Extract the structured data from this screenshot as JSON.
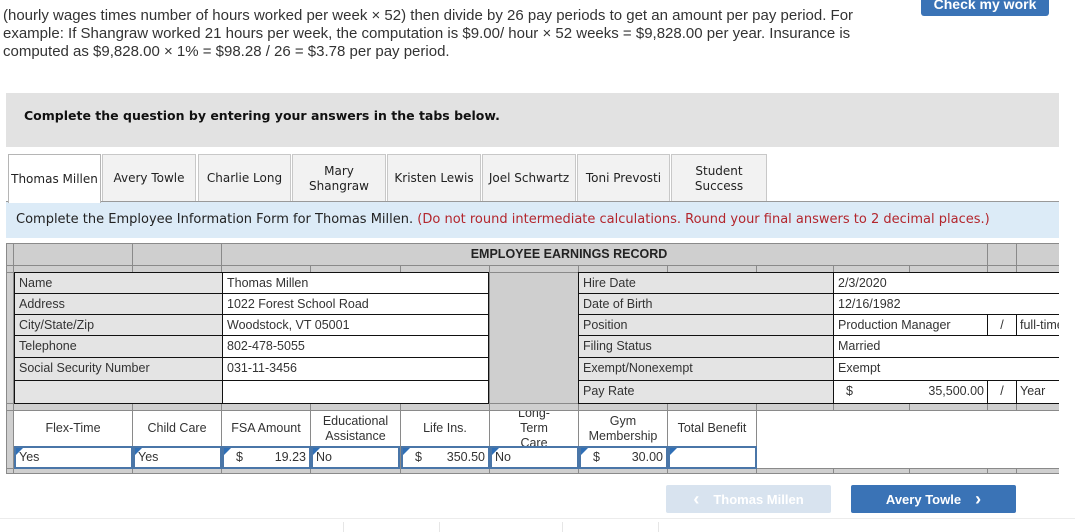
{
  "intro": {
    "line1": "(hourly wages times number of hours worked per week × 52) then divide by 26 pay periods to get an amount per pay period. For",
    "line2": "example: If Shangraw worked 21 hours per week, the computation is $9.00/ hour × 52 weeks = $9,828.00 per year. Insurance is",
    "line3": "computed as $9,828.00 × 1% = $98.28 / 26 = $3.78 per pay period."
  },
  "check_button": "Check my work",
  "instruction": "Complete the question by entering your answers in the tabs below.",
  "tabs": [
    {
      "label": "Thomas Millen",
      "active": true
    },
    {
      "label": "Avery Towle",
      "active": false
    },
    {
      "label": "Charlie Long",
      "active": false
    },
    {
      "label": "Mary Shangraw",
      "active": false
    },
    {
      "label": "Kristen Lewis",
      "active": false
    },
    {
      "label": "Joel Schwartz",
      "active": false
    },
    {
      "label": "Toni Prevosti",
      "active": false
    },
    {
      "label": "Student Success",
      "active": false
    }
  ],
  "form_banner": {
    "text": "Complete the Employee Information Form for Thomas Millen.",
    "note": "(Do not round intermediate calculations. Round your final answers to 2 decimal places.)"
  },
  "record": {
    "title": "EMPLOYEE EARNINGS RECORD",
    "left": [
      {
        "label": "Name",
        "value": "Thomas Millen"
      },
      {
        "label": "Address",
        "value": "1022 Forest School Road"
      },
      {
        "label": "City/State/Zip",
        "value": "Woodstock, VT 05001"
      },
      {
        "label": "Telephone",
        "value": "802-478-5055"
      },
      {
        "label": "Social Security Number",
        "value": "031-11-3456"
      },
      {
        "label": "",
        "value": ""
      }
    ],
    "right": [
      {
        "label": "Hire Date",
        "value": "2/3/2020"
      },
      {
        "label": "Date of Birth",
        "value": "12/16/1982"
      },
      {
        "label": "Position",
        "value": "Production Manager",
        "sep": "/",
        "extra": "full-time"
      },
      {
        "label": "Filing Status",
        "value": "Married"
      },
      {
        "label": "Exempt/Nonexempt",
        "value": "Exempt"
      },
      {
        "label": "Pay Rate",
        "currency": "$",
        "value": "35,500.00",
        "sep": "/",
        "extra": "Year"
      }
    ]
  },
  "benefits": {
    "headers": [
      "Flex-Time",
      "Child Care",
      "FSA Amount",
      "Educational Assistance",
      "Life Ins.",
      "Long-Term Care",
      "Gym Membership",
      "Total Benefit"
    ],
    "values": [
      {
        "value": "Yes"
      },
      {
        "value": "Yes"
      },
      {
        "currency": "$",
        "value": "19.23"
      },
      {
        "value": "No"
      },
      {
        "currency": "$",
        "value": "350.50"
      },
      {
        "value": "No"
      },
      {
        "currency": "$",
        "value": "30.00"
      },
      {
        "value": ""
      }
    ]
  },
  "nav": {
    "prev_label": "Thomas Millen",
    "next_label": "Avery Towle",
    "prev_icon": "‹",
    "next_icon": "›"
  }
}
